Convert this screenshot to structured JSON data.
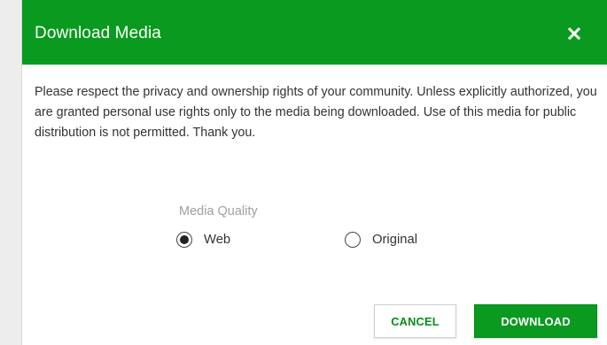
{
  "dialog": {
    "title": "Download Media",
    "close_icon": "close-icon",
    "message": "Please respect the privacy and ownership rights of your community. Unless explicitly authorized, you are granted personal use rights only to the media being downloaded. Use of this media for public distribution is not permitted. Thank you.",
    "quality": {
      "label": "Media Quality",
      "options": [
        {
          "label": "Web",
          "selected": true
        },
        {
          "label": "Original",
          "selected": false
        }
      ]
    },
    "buttons": {
      "cancel": "CANCEL",
      "download": "DOWNLOAD"
    }
  },
  "colors": {
    "header": "#099A1F",
    "primary_button": "#099A1F",
    "accent_text": "#078B1D"
  }
}
